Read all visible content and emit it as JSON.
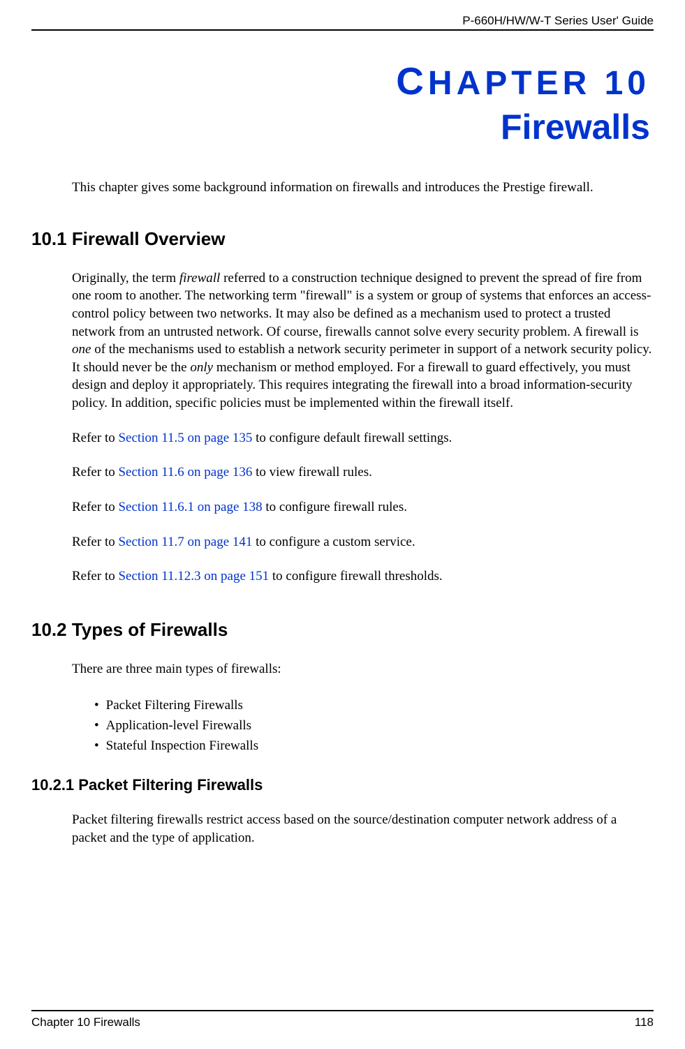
{
  "header": {
    "guide_title": "P-660H/HW/W-T Series User' Guide"
  },
  "chapter": {
    "label_prefix": "C",
    "label_rest": "HAPTER",
    "number": " 10",
    "title": "Firewalls"
  },
  "intro": "This chapter gives some background information on firewalls and introduces the Prestige firewall.",
  "section_10_1": {
    "heading": "10.1  Firewall Overview",
    "para1_a": "Originally, the term ",
    "para1_i1": "firewall",
    "para1_b": " referred to a construction technique designed to prevent the spread of fire from one room to another. The networking term \"firewall\" is a system or group of systems that enforces an access-control policy between two networks. It may also be defined as a mechanism used to protect a trusted network from an untrusted network. Of course, firewalls cannot solve every security problem. A firewall is ",
    "para1_i2": "one",
    "para1_c": " of the mechanisms used to establish a network security perimeter in support of a network security policy. It should never be the ",
    "para1_i3": "only",
    "para1_d": " mechanism or method employed. For a firewall to guard effectively, you must design and deploy it appropriately. This requires integrating the firewall into a broad information-security policy. In addition, specific policies must be implemented within the firewall itself.",
    "refer_prefix": "Refer to ",
    "ref1_link": "Section 11.5 on page 135",
    "ref1_tail": " to configure default firewall settings.",
    "ref2_link": "Section 11.6 on page 136",
    "ref2_tail": " to view firewall rules.",
    "ref3_link": "Section 11.6.1 on page 138",
    "ref3_tail": " to configure firewall rules.",
    "ref4_link": "Section 11.7 on page 141",
    "ref4_tail": " to configure a custom service.",
    "ref5_link": "Section 11.12.3 on page 151",
    "ref5_tail": " to configure firewall thresholds."
  },
  "section_10_2": {
    "heading": "10.2  Types of Firewalls",
    "intro": "There are three main types of firewalls:",
    "bullets": {
      "b1": "Packet Filtering Firewalls",
      "b2": "Application-level Firewalls",
      "b3": "Stateful Inspection Firewalls"
    }
  },
  "section_10_2_1": {
    "heading": "10.2.1  Packet Filtering Firewalls",
    "para": "Packet filtering firewalls restrict access based on the source/destination computer network address of a packet and the type of application."
  },
  "footer": {
    "chapter_label": "Chapter 10 Firewalls",
    "page_number": "118"
  }
}
